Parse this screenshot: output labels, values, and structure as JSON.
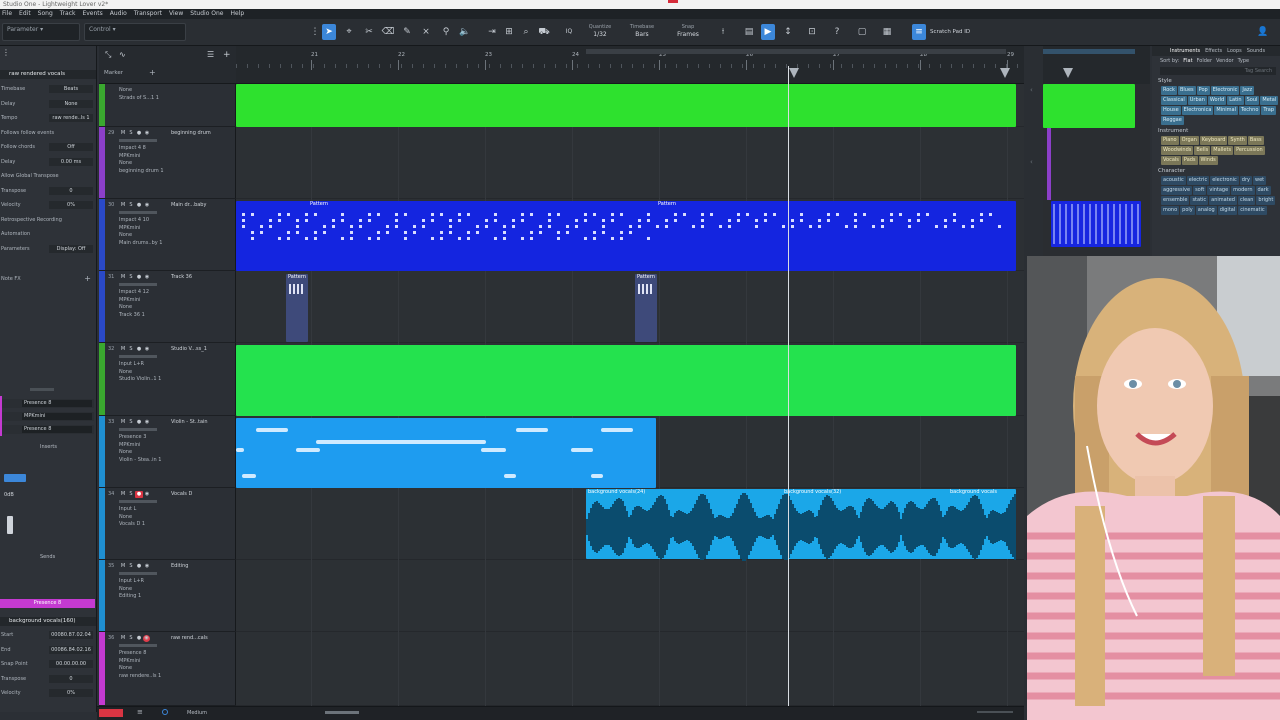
{
  "window": {
    "title": "Studio One - Lightweight Lover v2*"
  },
  "menu": [
    "File",
    "Edit",
    "Song",
    "Track",
    "Events",
    "Audio",
    "Transport",
    "View",
    "Studio One",
    "Help"
  ],
  "toolbar": {
    "param_label": "Parameter",
    "control_label": "Control",
    "quantize_label": "Quantize",
    "quantize_value": "1/32",
    "timebase_label": "Timebase",
    "timebase_value": "Bars",
    "snap_label": "Snap",
    "snap_value": "Frames",
    "iq_label": "IQ",
    "scratch_label": "Scratch Pad ID",
    "colors": {
      "accent": "#3c87d9"
    }
  },
  "inspector": {
    "header": "raw rendered vocals",
    "rows": [
      {
        "label": "Timebase",
        "value": "Beats"
      },
      {
        "label": "Delay",
        "value": "None"
      },
      {
        "label": "Tempo",
        "value": "raw rende..ls 1"
      },
      {
        "label": "Follows follow events",
        "value": ""
      },
      {
        "label": "Follow chords",
        "value": "Off"
      },
      {
        "label": "Delay",
        "value": "0.00 ms"
      },
      {
        "label": "Allow Global Transpose",
        "value": ""
      },
      {
        "label": "Transpose",
        "value": "0"
      },
      {
        "label": "Velocity",
        "value": "0%"
      },
      {
        "label": "Retrospective Recording",
        "value": ""
      },
      {
        "label": "Automation",
        "value": ""
      },
      {
        "label": "Parameters",
        "value": "Display: Off"
      }
    ],
    "note_fx_label": "Note FX",
    "presence_rows": [
      "Presence 8",
      "MPKmini",
      "Presence 8"
    ],
    "inserts_label": "Inserts",
    "sends_label": "Sends",
    "db_value": "0dB",
    "channel_name": "Presence 8",
    "event_name": "background vocals(160)",
    "event_rows": [
      {
        "label": "Start",
        "value": "00080.87.02.04"
      },
      {
        "label": "End",
        "value": "00086.84.02.16"
      },
      {
        "label": "Snap Point",
        "value": "00.00.00.00"
      },
      {
        "label": "Transpose",
        "value": "0"
      },
      {
        "label": "Velocity",
        "value": "0%"
      }
    ]
  },
  "trackpanel": {
    "marker_label": "Marker"
  },
  "tracks": [
    {
      "num": "",
      "name": "",
      "sub": [
        "None",
        "Strads of S...1 1"
      ],
      "color": "#3aa82f"
    },
    {
      "num": "29",
      "name": "beginning drum",
      "sub": [
        "Impact 4 8",
        "MPKmini",
        "None",
        "beginning drum 1"
      ],
      "color": "#8c3fc9"
    },
    {
      "num": "30",
      "name": "Main dr...baby",
      "sub": [
        "Impact 4 10",
        "MPKmini",
        "None",
        "Main drums..by 1"
      ],
      "color": "#2a49c7"
    },
    {
      "num": "31",
      "name": "Track 36",
      "sub": [
        "Impact 4 12",
        "MPKmini",
        "None",
        "Track 36 1"
      ],
      "color": "#2a49c7"
    },
    {
      "num": "32",
      "name": "Studio V...ss_1",
      "sub": [
        "Input L+R",
        "None",
        "Studio Violin..1 1"
      ],
      "color": "#3aa82f"
    },
    {
      "num": "33",
      "name": "Violin - St..tain",
      "sub": [
        "Presence 3",
        "MPKmini",
        "None",
        "Violin - Stea..in 1"
      ],
      "color": "#1f8fd1"
    },
    {
      "num": "34",
      "name": "Vocals D",
      "sub": [
        "Input L",
        "None",
        "Vocals D 1"
      ],
      "color": "#1f8fd1"
    },
    {
      "num": "35",
      "name": "Editing",
      "sub": [
        "Input L+R",
        "None",
        "Editing 1"
      ],
      "color": "#1f8fd1"
    },
    {
      "num": "36",
      "name": "raw rend...cals",
      "sub": [
        "Presence 8",
        "MPKmini",
        "None",
        "raw rendere..ls 1"
      ],
      "color": "#c43ad1"
    }
  ],
  "ruler": {
    "bars": [
      "21",
      "22",
      "23",
      "24",
      "25",
      "26",
      "27",
      "28",
      "29"
    ]
  },
  "clips": {
    "pattern_label": "Pattern",
    "vocals_labels": [
      "background vocals(24)",
      "background vocals(32)",
      "background vocals"
    ]
  },
  "browser": {
    "tabs": [
      "Instruments",
      "Effects",
      "Loops",
      "Sounds"
    ],
    "sort": [
      "Sort by:",
      "Flat",
      "Folder",
      "Vendor",
      "Type"
    ],
    "search_placeholder": "Tag Search",
    "style_title": "Style",
    "style_tags": [
      "Rock",
      "Blues",
      "Pop",
      "Electronic",
      "Jazz",
      "Classical",
      "Urban",
      "World",
      "Latin",
      "Soul",
      "Metal",
      "House",
      "Electronica",
      "Minimal",
      "Techno",
      "Trap",
      "Reggae"
    ],
    "instrument_title": "Instrument",
    "instrument_tags": [
      "Piano",
      "Organ",
      "Keyboard",
      "Synth",
      "Bass",
      "Woodwinds",
      "Bells",
      "Mallets",
      "Percussion",
      "Vocals",
      "Pads",
      "Winds"
    ],
    "character_title": "Character",
    "character_tags": [
      "acoustic",
      "electric",
      "electronic",
      "dry",
      "wet",
      "aggressive",
      "soft",
      "vintage",
      "modern",
      "dark",
      "ensemble",
      "static",
      "animated",
      "clean",
      "bright",
      "mono",
      "poly",
      "analog",
      "digital",
      "cinematic"
    ]
  },
  "bottombar": {
    "view_label": "Medium"
  }
}
